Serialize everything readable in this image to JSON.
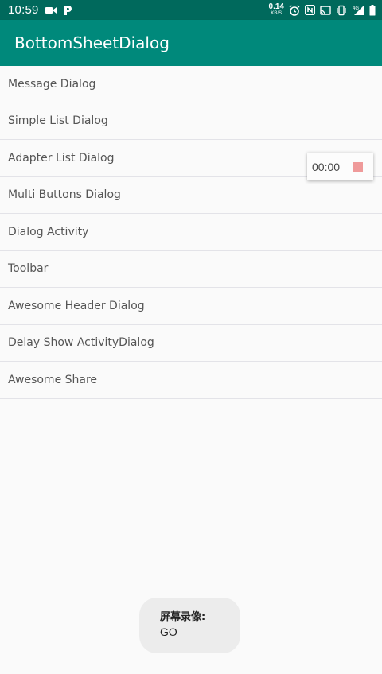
{
  "status_bar": {
    "time": "10:59",
    "net_speed_value": "0.14",
    "net_speed_unit": "KB/S",
    "network_type": "4G",
    "icons": [
      "video-camera-icon",
      "parking-app-icon",
      "alarm-icon",
      "nfc-icon",
      "cast-icon",
      "vibrate-icon",
      "signal-icon",
      "battery-icon"
    ]
  },
  "app_bar": {
    "title": "BottomSheetDialog"
  },
  "menu": {
    "items": [
      {
        "label": "Message Dialog"
      },
      {
        "label": "Simple List Dialog"
      },
      {
        "label": "Adapter List Dialog"
      },
      {
        "label": "Multi Buttons Dialog"
      },
      {
        "label": "Dialog Activity"
      },
      {
        "label": "Toolbar"
      },
      {
        "label": "Awesome Header Dialog"
      },
      {
        "label": "Delay Show ActivityDialog"
      },
      {
        "label": "Awesome Share"
      }
    ]
  },
  "recorder": {
    "time": "00:00",
    "stop_color": "#ef9a9a"
  },
  "toast": {
    "title": "屏幕录像:",
    "message": "GO"
  },
  "colors": {
    "status_bar": "#00695c",
    "app_bar": "#00897b",
    "background": "#fafafa",
    "divider": "#e3e3e8"
  }
}
